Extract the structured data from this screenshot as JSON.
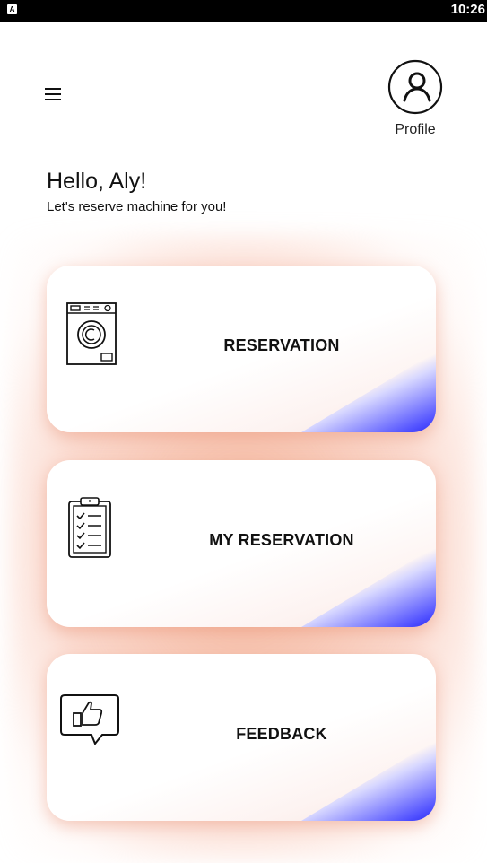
{
  "status_bar": {
    "app_badge": "A",
    "time": "10:26"
  },
  "header": {
    "menu_icon": "hamburger-menu-icon",
    "profile_icon": "user-circle-icon",
    "profile_label": "Profile"
  },
  "greeting": {
    "title": "Hello, Aly!",
    "subtitle": "Let's reserve machine for you!"
  },
  "cards": [
    {
      "label": "RESERVATION",
      "icon": "washing-machine-icon"
    },
    {
      "label": "MY RESERVATION",
      "icon": "clipboard-checklist-icon"
    },
    {
      "label": "FEEDBACK",
      "icon": "thumbs-up-feedback-icon"
    }
  ],
  "colors": {
    "accent_blue": "#2b2bf0",
    "glow": "#f3aa8c",
    "status_bar": "#000000"
  }
}
